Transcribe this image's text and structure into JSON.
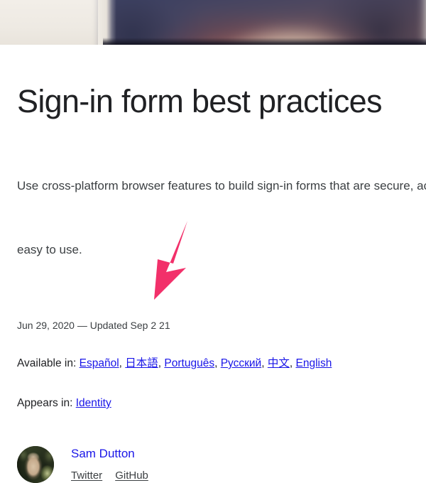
{
  "hero": {
    "image_alt": "blurred-header-photo"
  },
  "article": {
    "title": "Sign-in form best practices",
    "subtitle_line1": "Use cross-platform browser features to build sign-in forms that are secure, ac",
    "subtitle_line2": "easy to use.",
    "date_line": "Jun 29, 2020 — Updated Sep 2     21",
    "available_label": "Available in:",
    "languages": [
      {
        "label": "Español"
      },
      {
        "label": "日本語"
      },
      {
        "label": "Português"
      },
      {
        "label": "Русский"
      },
      {
        "label": "中文"
      },
      {
        "label": "English"
      }
    ],
    "language_separator": ", ",
    "appears_label": "Appears in:",
    "appears_link": "Identity"
  },
  "author": {
    "name": "Sam Dutton",
    "avatar_alt": "author-portrait",
    "social": [
      {
        "label": "Twitter"
      },
      {
        "label": "GitHub"
      }
    ]
  },
  "annotation": {
    "type": "arrow",
    "color": "#f2306a",
    "points_to": "日本語"
  },
  "colors": {
    "link_blue": "#1a16e8",
    "text_primary": "#202124",
    "text_secondary": "#3c4043",
    "annotation_pink": "#f2306a",
    "page_background": "#ffffff"
  }
}
